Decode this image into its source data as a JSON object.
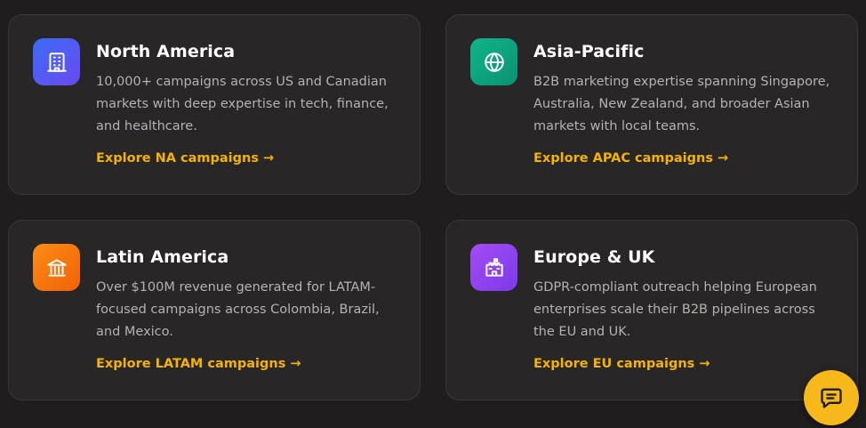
{
  "colors": {
    "accent_link": "#f5b301",
    "chat_button": "#f6b81b",
    "card_bg": "#282626",
    "page_bg": "#1f1d1d"
  },
  "regions": [
    {
      "icon": "building-icon",
      "title": "North America",
      "description": "10,000+ campaigns across US and Canadian markets with deep expertise in tech, finance, and healthcare.",
      "link": "Explore NA campaigns →"
    },
    {
      "icon": "globe-icon",
      "title": "Asia-Pacific",
      "description": "B2B marketing expertise spanning Singapore, Australia, New Zealand, and broader Asian markets with local teams.",
      "link": "Explore APAC campaigns →"
    },
    {
      "icon": "landmark-icon",
      "title": "Latin America",
      "description": "Over $100M revenue generated for LATAM-focused campaigns across Colombia, Brazil, and Mexico.",
      "link": "Explore LATAM campaigns →"
    },
    {
      "icon": "castle-icon",
      "title": "Europe & UK",
      "description": "GDPR-compliant outreach helping European enterprises scale their B2B pipelines across the EU and UK.",
      "link": "Explore EU campaigns →"
    }
  ],
  "chat_widget": {
    "icon": "chat-bubble-icon"
  }
}
